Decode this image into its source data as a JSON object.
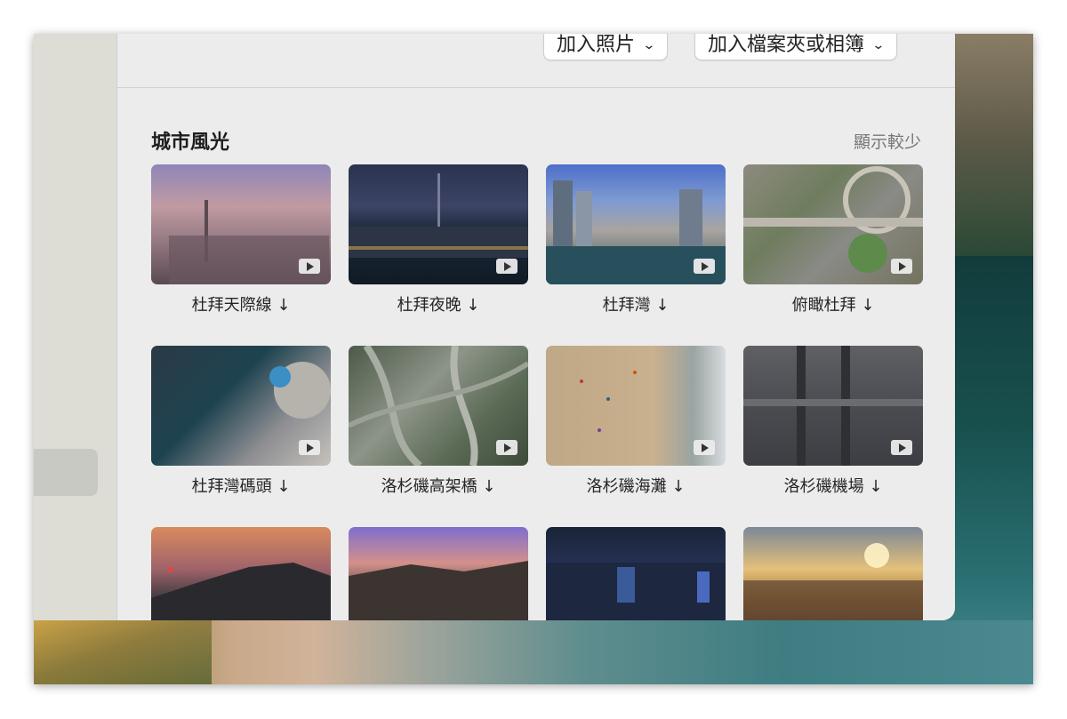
{
  "toolbar": {
    "add_photos_label": "加入照片",
    "add_folder_label": "加入檔案夾或相簿"
  },
  "section": {
    "title": "城市風光",
    "show_less_label": "顯示較少"
  },
  "tiles": [
    {
      "caption": "杜拜天際線 ↓"
    },
    {
      "caption": "杜拜夜晚 ↓"
    },
    {
      "caption": "杜拜灣 ↓"
    },
    {
      "caption": "俯瞰杜拜 ↓"
    },
    {
      "caption": "杜拜灣碼頭 ↓"
    },
    {
      "caption": "洛杉磯高架橋 ↓"
    },
    {
      "caption": "洛杉磯海灘 ↓"
    },
    {
      "caption": "洛杉磯機場 ↓"
    },
    {
      "caption": ""
    },
    {
      "caption": ""
    },
    {
      "caption": ""
    },
    {
      "caption": ""
    }
  ],
  "icons": {
    "play": "play-icon",
    "chevron": "chevron-down-icon"
  }
}
